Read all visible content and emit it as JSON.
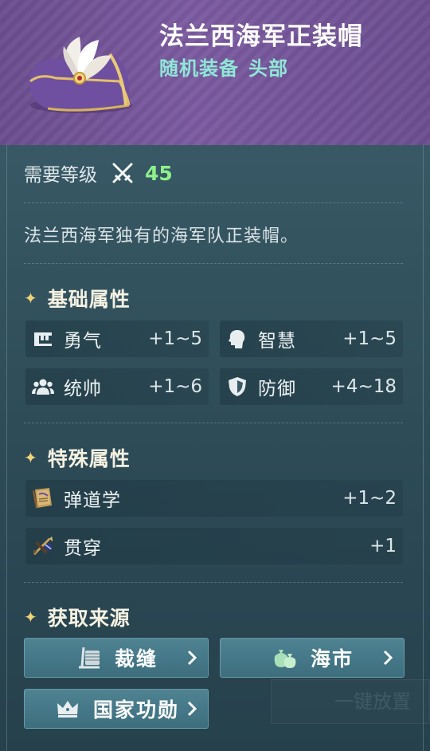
{
  "item": {
    "name": "法兰西海军正装帽",
    "type": "随机装备",
    "slot": "头部",
    "image_icon": "plumed-navy-bicorne-hat"
  },
  "requirement": {
    "label": "需要等级",
    "icon": "crossed-swords-icon",
    "level": "45"
  },
  "description": "法兰西海军独有的海军队正装帽。",
  "base_stats": {
    "title": "基础属性",
    "items": [
      {
        "icon": "courage-icon",
        "name": "勇气",
        "value": "+1~5"
      },
      {
        "icon": "wisdom-head-icon",
        "name": "智慧",
        "value": "+1~5"
      },
      {
        "icon": "command-people-icon",
        "name": "统帅",
        "value": "+1~6"
      },
      {
        "icon": "shield-icon",
        "name": "防御",
        "value": "+4~18"
      }
    ]
  },
  "special_stats": {
    "title": "特殊属性",
    "items": [
      {
        "icon": "ballistics-book-icon",
        "name": "弹道学",
        "value": "+1~2"
      },
      {
        "icon": "penetration-arrow-icon",
        "name": "贯穿",
        "value": "+1"
      }
    ]
  },
  "sources": {
    "title": "获取来源",
    "buttons": [
      {
        "icon": "tailoring-icon",
        "label": "裁缝"
      },
      {
        "icon": "money-bags-icon",
        "label": "海市"
      },
      {
        "icon": "crown-icon",
        "label": "国家功勋"
      }
    ]
  },
  "colors": {
    "header_purple": "#7b5aa0",
    "type_teal": "#8ee8d6",
    "level_green": "#8ff08a",
    "star_gold": "#f1d479",
    "button_teal": "#457888"
  },
  "background_ghost_text": "一键放置"
}
